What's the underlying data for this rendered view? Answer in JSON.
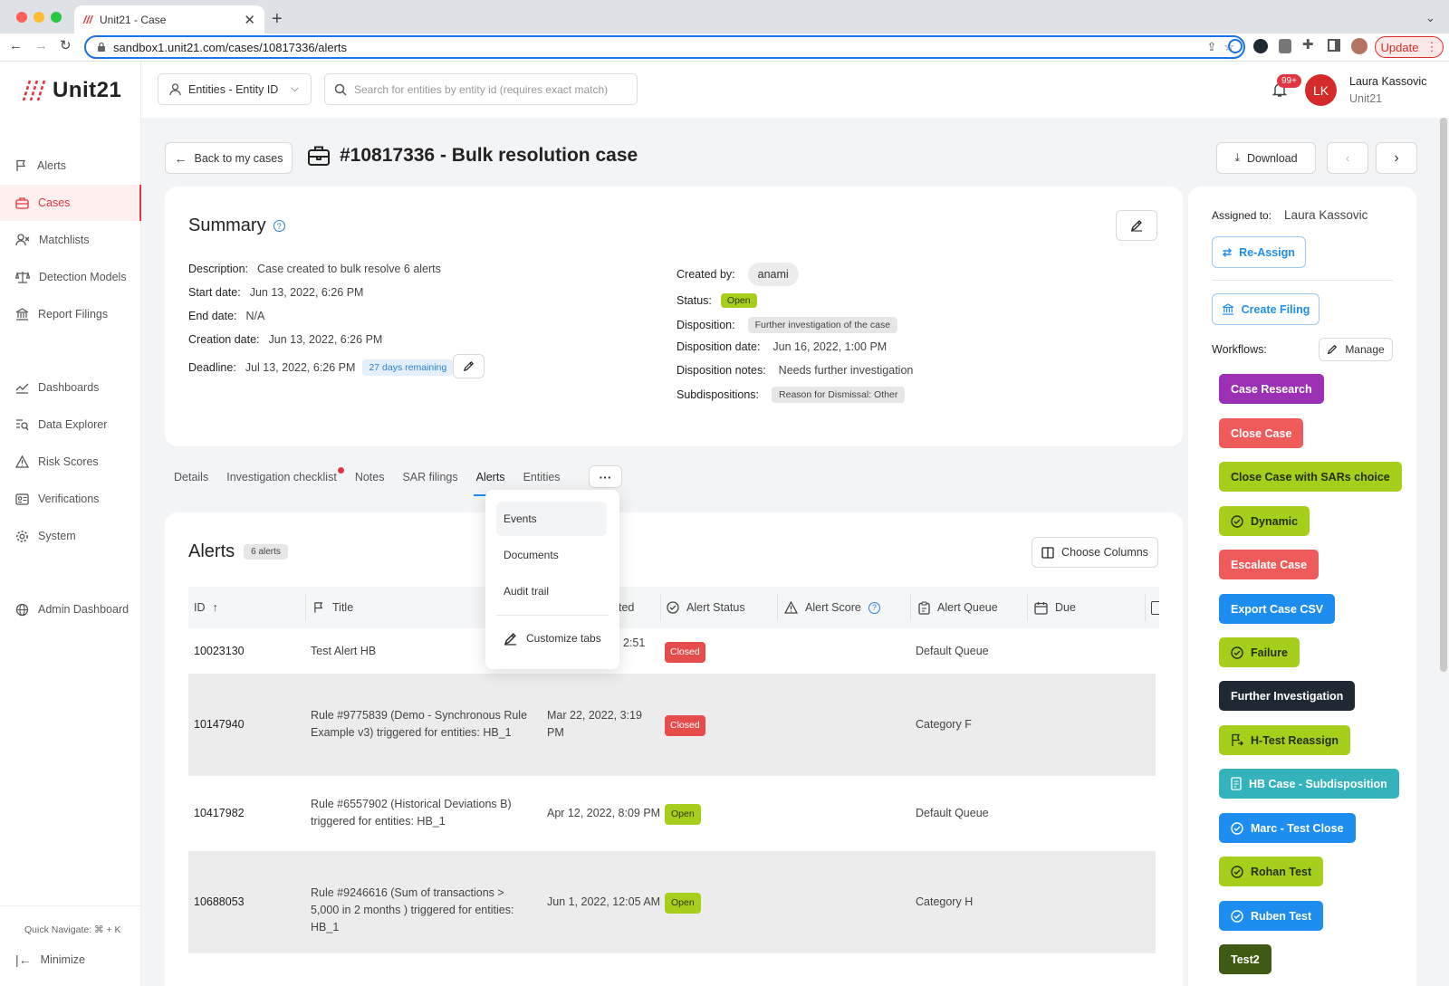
{
  "browser": {
    "tab_title": "Unit21 - Case",
    "url": "sandbox1.unit21.com/cases/10817336/alerts",
    "update_label": "Update"
  },
  "sidebar": {
    "brand": "Unit21",
    "items": [
      {
        "label": "Alerts",
        "icon": "flag-icon"
      },
      {
        "label": "Cases",
        "icon": "briefcase-icon"
      },
      {
        "label": "Matchlists",
        "icon": "user-x-icon"
      },
      {
        "label": "Detection Models",
        "icon": "scale-icon"
      },
      {
        "label": "Report Filings",
        "icon": "bank-icon"
      },
      {
        "label": "Dashboards",
        "icon": "chart-icon"
      },
      {
        "label": "Data Explorer",
        "icon": "search-list-icon"
      },
      {
        "label": "Risk Scores",
        "icon": "warning-icon"
      },
      {
        "label": "Verifications",
        "icon": "id-card-icon"
      },
      {
        "label": "System",
        "icon": "gear-icon"
      },
      {
        "label": "Admin Dashboard",
        "icon": "globe-icon"
      }
    ],
    "quick_navigate": "Quick Navigate: ⌘ + K",
    "minimize": "Minimize"
  },
  "topbar": {
    "entity_select": "Entities - Entity ID",
    "search_placeholder": "Search for entities by entity id (requires exact match)",
    "notifications_badge": "99+",
    "user_initials": "LK",
    "user_name": "Laura Kassovic",
    "user_org": "Unit21"
  },
  "page": {
    "back_label": "Back to my cases",
    "title": "#10817336 - Bulk resolution case",
    "download_label": "Download"
  },
  "summary": {
    "heading": "Summary",
    "description_label": "Description:",
    "description": "Case created to bulk resolve 6 alerts",
    "start_label": "Start date:",
    "start": "Jun 13, 2022, 6:26 PM",
    "end_label": "End date:",
    "end": "N/A",
    "creation_label": "Creation date:",
    "creation": "Jun 13, 2022, 6:26 PM",
    "deadline_label": "Deadline:",
    "deadline": "Jul 13, 2022, 6:26 PM",
    "deadline_badge": "27 days remaining",
    "created_by_label": "Created by:",
    "created_by": "anami",
    "status_label": "Status:",
    "status": "Open",
    "disposition_label": "Disposition:",
    "disposition": "Further investigation of the case",
    "disposition_date_label": "Disposition date:",
    "disposition_date": "Jun 16, 2022, 1:00 PM",
    "disposition_notes_label": "Disposition notes:",
    "disposition_notes": "Needs further investigation",
    "subdispositions_label": "Subdispositions:",
    "subdispositions": "Reason for Dismissal: Other"
  },
  "tabs": [
    "Details",
    "Investigation checklist",
    "Notes",
    "SAR filings",
    "Alerts",
    "Entities"
  ],
  "more_menu": [
    "Events",
    "Documents",
    "Audit trail",
    "Customize tabs"
  ],
  "alerts": {
    "heading": "Alerts",
    "count_badge": "6 alerts",
    "choose_columns": "Choose Columns",
    "columns": [
      "ID",
      "Title",
      "ted",
      "Alert Status",
      "Alert Score",
      "Alert Queue",
      "Due"
    ],
    "rows": [
      {
        "id": "10023130",
        "title": "Test Alert HB",
        "created": "2:51",
        "status": "Closed",
        "queue": "Default Queue"
      },
      {
        "id": "10147940",
        "title": "Rule #9775839 (Demo - Synchronous Rule Example v3) triggered for entities: HB_1",
        "created": "Mar 22, 2022, 3:19 PM",
        "status": "Closed",
        "queue": "Category F"
      },
      {
        "id": "10417982",
        "title": "Rule #6557902 (Historical Deviations B) triggered for entities: HB_1",
        "created": "Apr 12, 2022, 8:09 PM",
        "status": "Open",
        "queue": "Default Queue"
      },
      {
        "id": "10688053",
        "title": "Rule #9246616 (Sum of transactions > 5,000 in 2 months ) triggered for entities: HB_1",
        "created": "Jun 1, 2022, 12:05 AM",
        "status": "Open",
        "queue": "Category H"
      }
    ]
  },
  "assign": {
    "label": "Assigned to:",
    "name": "Laura Kassovic",
    "reassign": "Re-Assign",
    "create_filing": "Create Filing",
    "workflows_label": "Workflows:",
    "manage": "Manage"
  },
  "workflows": [
    {
      "label": "Case Research",
      "bg": "#9b30b5",
      "fg": "#ffffff",
      "icon": ""
    },
    {
      "label": "Close Case",
      "bg": "#ef5a5a",
      "fg": "#ffffff",
      "icon": ""
    },
    {
      "label": "Close Case with SARs choice",
      "bg": "#a6cf1b",
      "fg": "#24300a",
      "icon": ""
    },
    {
      "label": "Dynamic",
      "bg": "#a6cf1b",
      "fg": "#24300a",
      "icon": "check-circle-icon"
    },
    {
      "label": "Escalate Case",
      "bg": "#ef5a5a",
      "fg": "#ffffff",
      "icon": ""
    },
    {
      "label": "Export Case CSV",
      "bg": "#1d8ef0",
      "fg": "#ffffff",
      "icon": ""
    },
    {
      "label": "Failure",
      "bg": "#a6cf1b",
      "fg": "#24300a",
      "icon": "check-circle-icon"
    },
    {
      "label": "Further Investigation",
      "bg": "#1f2933",
      "fg": "#ffffff",
      "icon": ""
    },
    {
      "label": "H-Test Reassign",
      "bg": "#a6cf1b",
      "fg": "#24300a",
      "icon": "flag-arrow-icon"
    },
    {
      "label": "HB Case - Subdisposition",
      "bg": "#34b3bd",
      "fg": "#ffffff",
      "icon": "document-icon"
    },
    {
      "label": "Marc - Test Close",
      "bg": "#1d8ef0",
      "fg": "#ffffff",
      "icon": "check-circle-icon"
    },
    {
      "label": "Rohan Test",
      "bg": "#a6cf1b",
      "fg": "#24300a",
      "icon": "check-circle-icon"
    },
    {
      "label": "Ruben Test",
      "bg": "#1d8ef0",
      "fg": "#ffffff",
      "icon": "check-circle-icon"
    },
    {
      "label": "Test2",
      "bg": "#3f5a12",
      "fg": "#ffffff",
      "icon": ""
    }
  ]
}
